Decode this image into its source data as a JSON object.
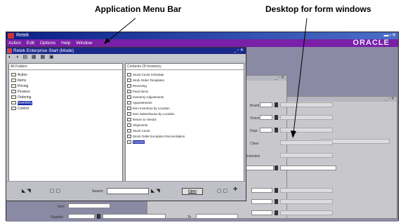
{
  "annotations": {
    "menu_bar": "Application Menu Bar",
    "desktop": "Desktop for form windows"
  },
  "app": {
    "title": "Retek",
    "window_controls": "▬▫✕",
    "brand": "ORACLE"
  },
  "menu": [
    "Action",
    "Edit",
    "Options",
    "Help",
    "Window"
  ],
  "start_window": {
    "title": "Retek Enterprise Start      (Mode)",
    "controls": "_ ▫ ✕",
    "toolbar_icons": "◐ ◑ ▤ ▦ ▩ ▣",
    "left_pane_header": "All Folders",
    "right_pane_header": "Contents Of Inventory",
    "folders": [
      {
        "label": "Action",
        "selected": false
      },
      {
        "label": "Items",
        "selected": false
      },
      {
        "label": "Pricing",
        "selected": false
      },
      {
        "label": "Finance",
        "selected": false
      },
      {
        "label": "Ordering",
        "selected": false
      },
      {
        "label": "Inventory",
        "selected": true
      },
      {
        "label": "Control",
        "selected": false
      }
    ],
    "contents": [
      {
        "label": "Stock Count Schedule",
        "selected": false
      },
      {
        "label": "Work Order Templates",
        "selected": false
      },
      {
        "label": "Receiving",
        "selected": false
      },
      {
        "label": "Pack Items",
        "selected": false
      },
      {
        "label": "Inventory Adjustments",
        "selected": false
      },
      {
        "label": "Appointments",
        "selected": false
      },
      {
        "label": "Item Inventory by Location",
        "selected": false
      },
      {
        "label": "Item Sales/Issues by Location",
        "selected": false
      },
      {
        "label": "Return to Vendor",
        "selected": false
      },
      {
        "label": "Shipments",
        "selected": false
      },
      {
        "label": "Stock Count",
        "selected": false
      },
      {
        "label": "Stock Order Exception Reconciliation",
        "selected": false
      },
      {
        "label": "Transfer",
        "selected": true
      }
    ],
    "bottom": {
      "search_label": "Search",
      "open_label": "Open",
      "nav_icons_left": "◣ ◥",
      "nav_icons_mid": "▢ ▢",
      "nav_icons_right": "▢ ▢",
      "plus": "+"
    }
  },
  "form_a": {
    "controls": "_ ▫ ✕",
    "labels": [
      "Brand",
      "Vision",
      "Dept",
      "Class",
      "Subclass"
    ]
  },
  "form_b": {
    "controls": "_ ▫ ✕",
    "labels": [
      "Item",
      "Supplier",
      "To"
    ]
  }
}
